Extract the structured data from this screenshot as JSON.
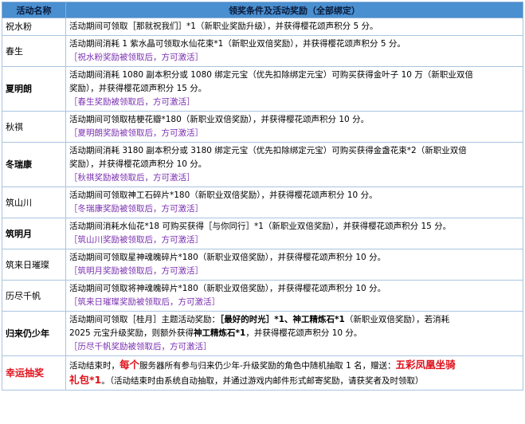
{
  "header": {
    "col1": "活动名称",
    "col2": "领奖条件及活动奖励（全部绑定）"
  },
  "rows": [
    {
      "name": "祝水粉",
      "line1": "活动期间可领取［那就祝我们］*1（新职业奖励升级），并获得樱花颂声积分 5 分。"
    },
    {
      "name": "春生",
      "line1": "活动期间消耗 1 紫水晶可领取水仙花束*1（新职业双倍奖励），并获得樱花颂声积分 5 分。",
      "note": "［祝水粉奖励被领取后，方可激活］"
    },
    {
      "name": "夏明朗",
      "line1": "活动期间消耗 1080 副本积分或 1080 绑定元宝（优先扣除绑定元宝）可购买获得金叶子 10 万（新职业双倍",
      "line2": "奖励），并获得樱花颂声积分 15 分。",
      "note": "［春生奖励被领取后，方可激活］"
    },
    {
      "name": "秋祺",
      "line1": "活动期间可领取桔梗花瓣*180（新职业双倍奖励），并获得樱花颂声积分 10 分。",
      "note": "［夏明朗奖励被领取后，方可激活］"
    },
    {
      "name": "冬瑞康",
      "line1": "活动期间消耗 3180 副本积分或 3180 绑定元宝（优先扣除绑定元宝）可购买获得金盏花束*2（新职业双倍",
      "line2": "奖励），并获得樱花颂声积分 10 分。",
      "note": "［秋祺奖励被领取后，方可激活］"
    },
    {
      "name": "筑山川",
      "line1": "活动期间可领取神工石碎片*180（新职业双倍奖励），并获得樱花颂声积分 10 分。",
      "note": "［冬瑞康奖励被领取后，方可激活］"
    },
    {
      "name": "筑明月",
      "line1": "活动期间消耗水仙花*18 可购买获得［与你同行］*1（新职业双倍奖励），并获得樱花颂声积分 15 分。",
      "note": "［筑山川奖励被领取后，方可激活］"
    },
    {
      "name": "筑来日璀璨",
      "line1": "活动期间可领取星神魂魄碎片*180（新职业双倍奖励），并获得樱花颂声积分 10 分。",
      "note": "［筑明月奖励被领取后，方可激活］"
    },
    {
      "name": "历尽千帆",
      "line1": "活动期间可领取将神魂魄碎片*180（新职业双倍奖励），并获得樱花颂声积分 10 分。",
      "note": "［筑来日璀璨奖励被领取后，方可激活］"
    },
    {
      "name": "归来仍少年",
      "line1_pre": "活动期间可领取［桂月］主题活动奖励：",
      "line1_bold": "［最好的时光］*1、神工精炼石*1",
      "line1_post": "（新职业双倍奖励），若消耗",
      "line2_pre": "2025 元宝升级奖励，则额外获得",
      "line2_bold": "神工精炼石*1",
      "line2_post": "，并获得樱花颂声积分 10 分。",
      "note": "［历尽千帆奖励被领取后，方可激活］"
    },
    {
      "name": "幸运抽奖",
      "p1": "活动结束时，",
      "p2": "每个",
      "p3": "服务器所有参与归来仍少年-升级奖励的角色中随机抽取 1 名，赠送：",
      "p4": "五彩凤凰坐骑",
      "p5": "礼包*1",
      "p6": "。（活动结束时由系统自动抽取，并通过游戏内邮件形式邮寄奖励，请获奖者及时领取）"
    }
  ]
}
